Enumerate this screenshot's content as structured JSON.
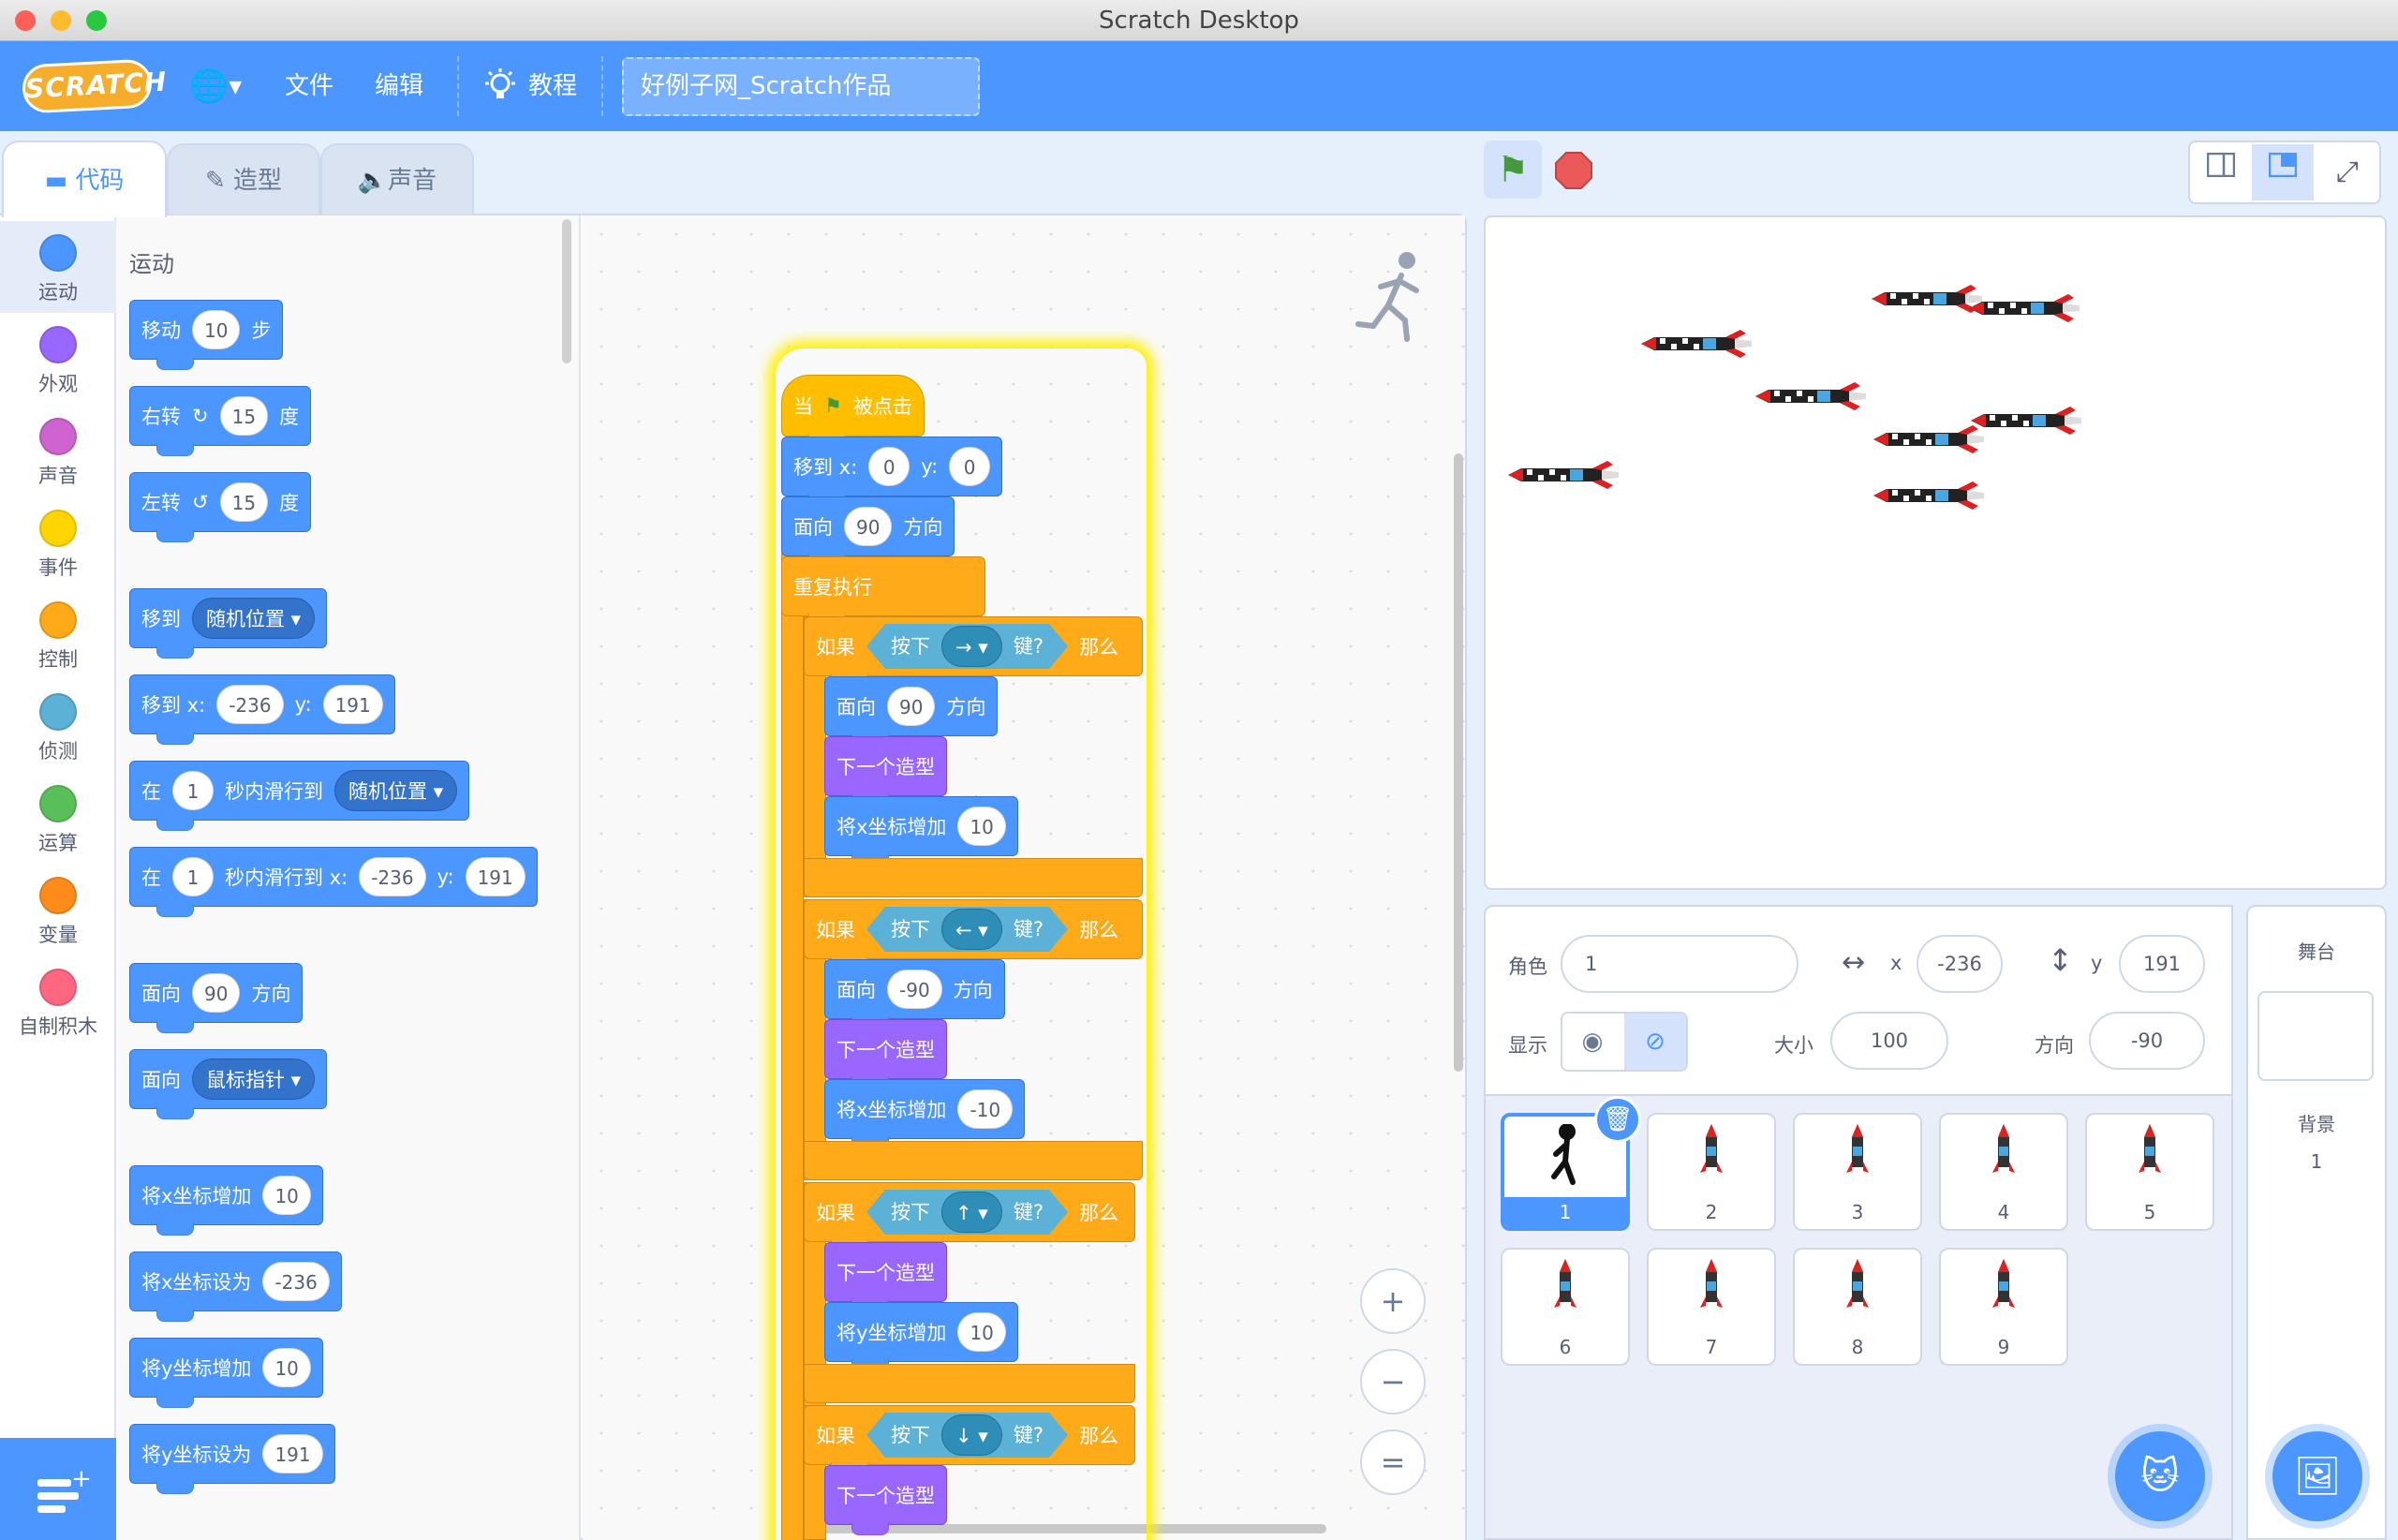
{
  "window": {
    "title": "Scratch Desktop"
  },
  "menu": {
    "logo": "SCRATCH",
    "globe": "🌐",
    "file": "文件",
    "edit": "编辑",
    "tutorials": "教程",
    "project_title": "好例子网_Scratch作品"
  },
  "tabs": {
    "code": "代码",
    "costumes": "造型",
    "sounds": "声音"
  },
  "categories": [
    {
      "label": "运动",
      "color": "#4c97ff"
    },
    {
      "label": "外观",
      "color": "#9966ff"
    },
    {
      "label": "声音",
      "color": "#cf63cf"
    },
    {
      "label": "事件",
      "color": "#ffd500"
    },
    {
      "label": "控制",
      "color": "#ffab19"
    },
    {
      "label": "侦测",
      "color": "#5cb1d6"
    },
    {
      "label": "运算",
      "color": "#59c059"
    },
    {
      "label": "变量",
      "color": "#ff8c1a"
    },
    {
      "label": "自制积木",
      "color": "#ff6680"
    }
  ],
  "palette": {
    "heading": "运动",
    "b1": {
      "a": "移动",
      "v": "10",
      "b": "步"
    },
    "b2": {
      "a": "右转",
      "v": "15",
      "b": "度"
    },
    "b3": {
      "a": "左转",
      "v": "15",
      "b": "度"
    },
    "b4": {
      "a": "移到",
      "d": "随机位置"
    },
    "b5": {
      "a": "移到 x:",
      "x": "-236",
      "b": "y:",
      "y": "191"
    },
    "b6": {
      "a": "在",
      "v": "1",
      "b": "秒内滑行到",
      "d": "随机位置"
    },
    "b7": {
      "a": "在",
      "v": "1",
      "b": "秒内滑行到 x:",
      "x": "-236",
      "c": "y:",
      "y": "191"
    },
    "b8": {
      "a": "面向",
      "v": "90",
      "b": "方向"
    },
    "b9": {
      "a": "面向",
      "d": "鼠标指针"
    },
    "b10": {
      "a": "将x坐标增加",
      "v": "10"
    },
    "b11": {
      "a": "将x坐标设为",
      "v": "-236"
    },
    "b12": {
      "a": "将y坐标增加",
      "v": "10"
    },
    "b13": {
      "a": "将y坐标设为",
      "v": "191"
    }
  },
  "script": {
    "hat": {
      "a": "当",
      "b": "被点击"
    },
    "goto": {
      "a": "移到 x:",
      "x": "0",
      "b": "y:",
      "y": "0"
    },
    "point": {
      "a": "面向",
      "v": "90",
      "b": "方向"
    },
    "forever": "重复执行",
    "if1": {
      "a": "如果",
      "key_a": "按下",
      "key": "→",
      "key_b": "键?",
      "then": "那么",
      "s1a": "面向",
      "s1v": "90",
      "s1b": "方向",
      "s2": "下一个造型",
      "s3a": "将x坐标增加",
      "s3v": "10"
    },
    "if2": {
      "a": "如果",
      "key_a": "按下",
      "key": "←",
      "key_b": "键?",
      "then": "那么",
      "s1a": "面向",
      "s1v": "-90",
      "s1b": "方向",
      "s2": "下一个造型",
      "s3a": "将x坐标增加",
      "s3v": "-10"
    },
    "if3": {
      "a": "如果",
      "key_a": "按下",
      "key": "↑",
      "key_b": "键?",
      "then": "那么",
      "s2": "下一个造型",
      "s3a": "将y坐标增加",
      "s3v": "10"
    },
    "if4": {
      "a": "如果",
      "key_a": "按下",
      "key": "↓",
      "key_b": "键?",
      "then": "那么",
      "s2": "下一个造型"
    }
  },
  "zoom": {
    "in": "+",
    "out": "−",
    "reset": "="
  },
  "sprite_info": {
    "sprite_label": "角色",
    "sprite_name": "1",
    "x_label": "x",
    "x": "-236",
    "y_label": "y",
    "y": "191",
    "show_label": "显示",
    "size_label": "大小",
    "size": "100",
    "direction_label": "方向",
    "direction": "-90"
  },
  "sprites": [
    "1",
    "2",
    "3",
    "4",
    "5",
    "6",
    "7",
    "8",
    "9"
  ],
  "stage_panel": {
    "title": "舞台",
    "backdrop_label": "背景",
    "backdrop_count": "1"
  }
}
